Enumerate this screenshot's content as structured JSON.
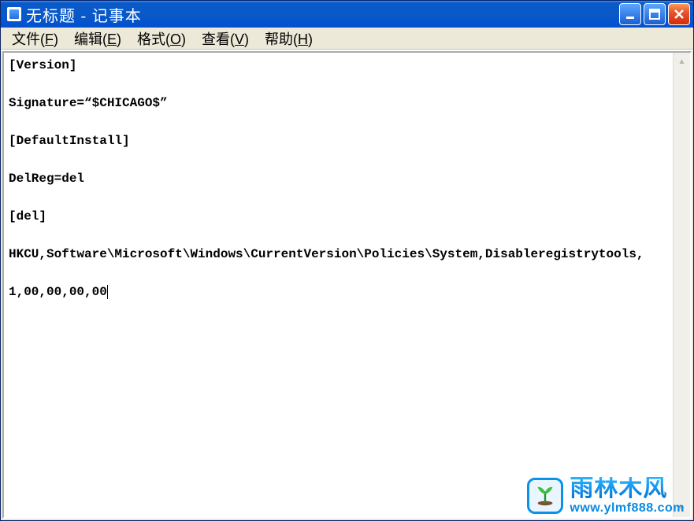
{
  "titlebar": {
    "title": "无标题 - 记事本"
  },
  "menubar": {
    "file": {
      "label": "文件",
      "accel": "F"
    },
    "edit": {
      "label": "编辑",
      "accel": "E"
    },
    "format": {
      "label": "格式",
      "accel": "O"
    },
    "view": {
      "label": "查看",
      "accel": "V"
    },
    "help": {
      "label": "帮助",
      "accel": "H"
    }
  },
  "content": {
    "lines": [
      "[Version]",
      "",
      "Signature=“$CHICAGO$”",
      "",
      "[DefaultInstall]",
      "",
      "DelReg=del",
      "",
      "[del]",
      "",
      "HKCU,Software\\Microsoft\\Windows\\CurrentVersion\\Policies\\System,Disableregistrytools,",
      "",
      "1,00,00,00,00"
    ]
  },
  "watermark": {
    "brand": "雨林木风",
    "url": "www.ylmf888.com"
  }
}
